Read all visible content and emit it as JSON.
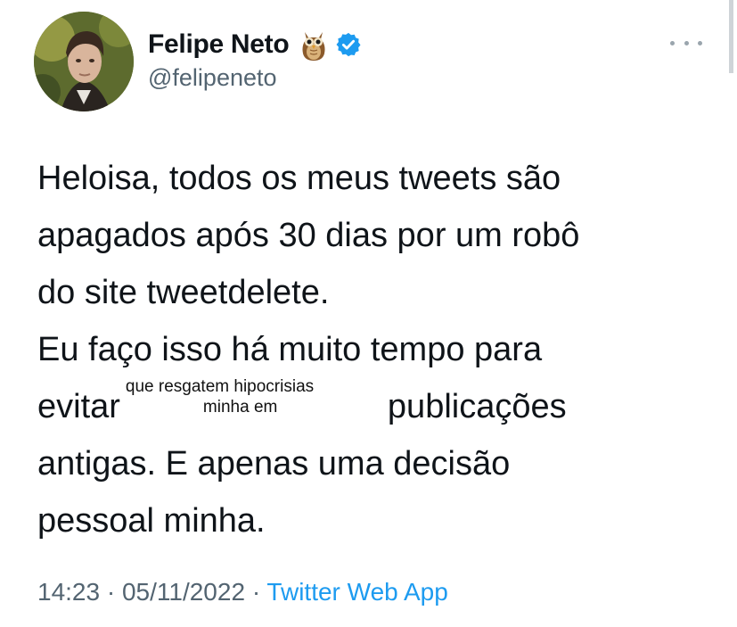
{
  "tweet": {
    "author": {
      "display_name": "Felipe Neto",
      "handle": "@felipeneto",
      "emoji_icon": "owl-emoji",
      "verified_icon": "verified-badge-icon",
      "avatar_icon": "profile-avatar"
    },
    "more_icon": "more-options-icon",
    "paragraphs": {
      "p1": [
        "Heloisa, todos os meus tweets são",
        "apagados após 30 dias por um robô",
        "do site tweetdelete."
      ],
      "p2": {
        "line1": "Eu faço isso há muito tempo para",
        "line2_start": "evitar",
        "handwritten_top": "que resgatem hipocrisias",
        "handwritten_bottom": "minha em",
        "line2_end": "publicações",
        "line3": "antigas. E apenas uma decisão",
        "line4": "pessoal minha."
      }
    },
    "time": "14:23",
    "date": "05/11/2022",
    "separator": "·",
    "source": "Twitter Web App"
  },
  "colors": {
    "text_primary": "#0f1419",
    "text_secondary": "#536471",
    "link": "#1d9bf0",
    "verified": "#1d9bf0"
  }
}
